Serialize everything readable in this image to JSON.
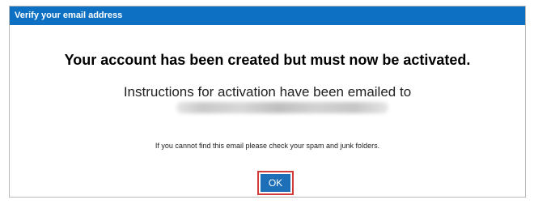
{
  "dialog": {
    "title": "Verify your email address",
    "headline": "Your account has been created but must now be activated.",
    "instructions": "Instructions for activation have been emailed to",
    "email": "",
    "note": "If you cannot find this email please check your spam and junk folders.",
    "ok_label": "OK"
  },
  "colors": {
    "titlebar": "#0d70c2",
    "button": "#1d6fb8",
    "focus_outline": "#d23b3b"
  }
}
